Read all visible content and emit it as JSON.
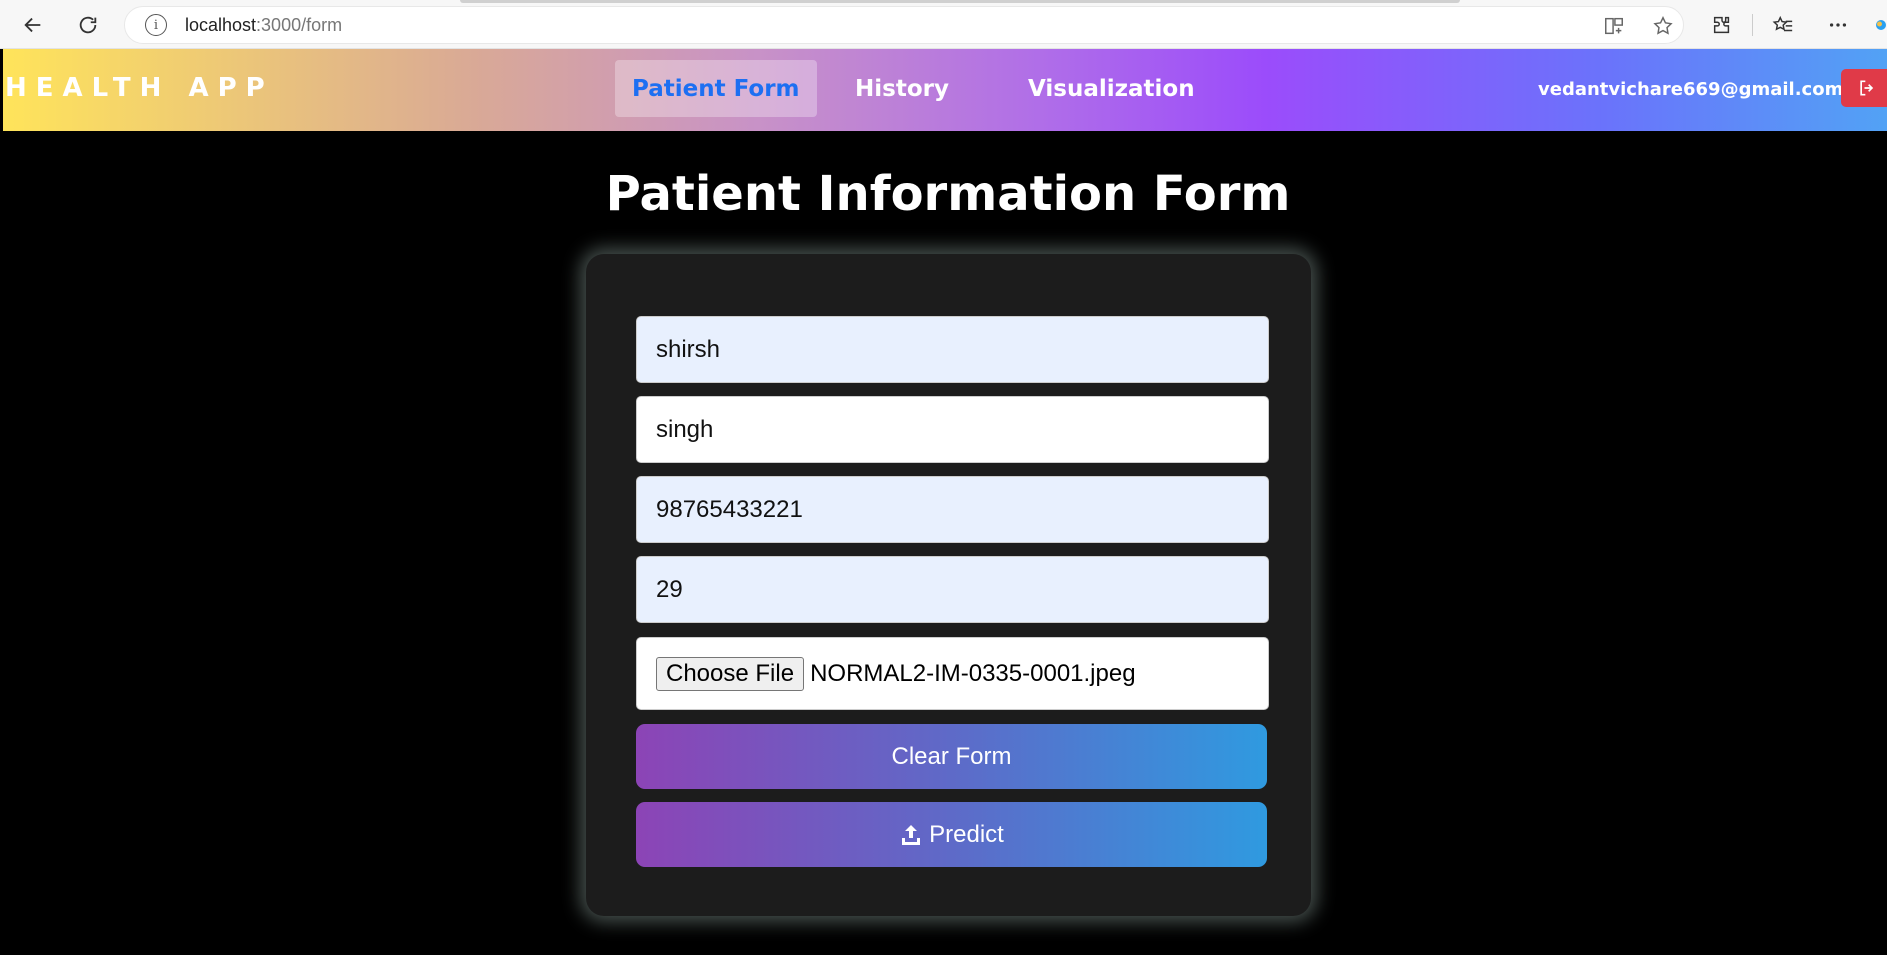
{
  "browser": {
    "url_host": "localhost",
    "url_path": ":3000/form"
  },
  "navbar": {
    "brand": "HEALTH APP",
    "links": [
      {
        "label": "Patient Form",
        "active": true
      },
      {
        "label": "History",
        "active": false
      },
      {
        "label": "Visualization",
        "active": false
      }
    ],
    "user_email": "vedantvichare669@gmail.com"
  },
  "page": {
    "title": "Patient Information Form"
  },
  "form": {
    "first_name": "shirsh",
    "last_name": "singh",
    "phone": "98765433221",
    "age": "29",
    "file_button_label": "Choose File",
    "file_name": "NORMAL2-IM-0335-0001.jpeg",
    "clear_label": "Clear Form",
    "predict_label": "Predict"
  },
  "colors": {
    "active_link": "#1d6ff2",
    "logout_bg": "#e03a48",
    "button_gradient_start": "#8c44b6",
    "button_gradient_end": "#2f9ae0"
  },
  "icons": {
    "back": "arrow-left-icon",
    "reload": "reload-icon",
    "site_info": "info-icon",
    "logout": "logout-icon",
    "predict": "upload-icon"
  }
}
